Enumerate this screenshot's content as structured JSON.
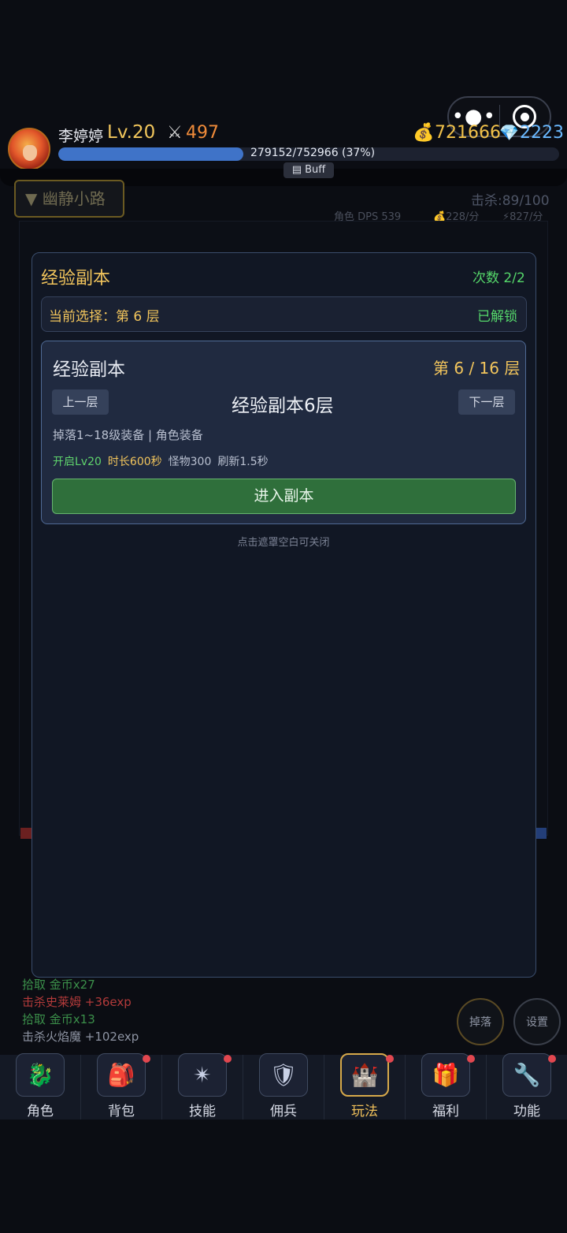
{
  "player": {
    "name": "李婷婷",
    "level": "Lv.20",
    "power": "497",
    "gold": "721666",
    "diamonds": "2223",
    "exp_text": "279152/752966 (37%)",
    "exp_fraction": 0.37,
    "buff_label": "Buff"
  },
  "scene": {
    "map_name": "▼ 幽静小路",
    "kills": "击杀:89/100",
    "dps": "角色 DPS 539",
    "gold_rate": "💰228/分",
    "energy_rate": "⚡827/分",
    "log": [
      {
        "text": "拾取 金币x27",
        "type": "green"
      },
      {
        "text": "击杀史莱姆 +36exp",
        "type": "hl"
      },
      {
        "text": "拾取 金币x13",
        "type": "green"
      },
      {
        "text": "击杀火焰魔 +102exp",
        "type": "white"
      }
    ],
    "round_buttons": {
      "drop": "掉落",
      "settings": "设置"
    }
  },
  "modal": {
    "title": "经验副本",
    "count": "次数 2/2",
    "current_selection": "当前选择：第 6 层",
    "status": "已解锁",
    "card": {
      "title": "经验副本",
      "floor": "第 6 / 16 层",
      "prev": "上一层",
      "next": "下一层",
      "name": "经验副本6层",
      "drop": "掉落1~18级装备 | 角色装备",
      "unlock_level": "开启Lv20",
      "duration": "时长600秒",
      "monsters": "怪物300",
      "refresh": "刷新1.5秒",
      "enter": "进入副本"
    },
    "hint": "点击遮罩空白可关闭"
  },
  "nav": [
    {
      "label": "角色",
      "icon": "character-icon",
      "glyph": "🐉",
      "badge": false,
      "active": false
    },
    {
      "label": "背包",
      "icon": "backpack-icon",
      "glyph": "🎒",
      "badge": true,
      "active": false
    },
    {
      "label": "技能",
      "icon": "skill-icon",
      "glyph": "✴",
      "badge": true,
      "active": false
    },
    {
      "label": "佣兵",
      "icon": "mercenary-icon",
      "glyph": "🛡",
      "badge": false,
      "active": false
    },
    {
      "label": "玩法",
      "icon": "gameplay-icon",
      "glyph": "🏰",
      "badge": true,
      "active": true
    },
    {
      "label": "福利",
      "icon": "welfare-icon",
      "glyph": "🎁",
      "badge": true,
      "active": false
    },
    {
      "label": "功能",
      "icon": "function-icon",
      "glyph": "🔧",
      "badge": true,
      "active": false
    }
  ],
  "colors": {
    "accent_gold": "#f2c55c",
    "accent_green": "#55d76a",
    "exp_blue": "#3f73c8"
  }
}
